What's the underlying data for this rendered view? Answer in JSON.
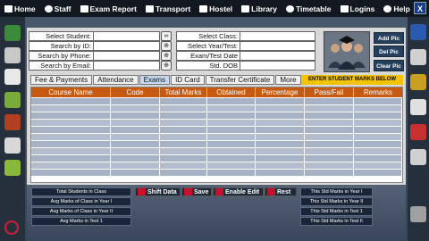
{
  "nav": {
    "items": [
      {
        "label": "Home",
        "icon": "home-icon"
      },
      {
        "label": "Staff",
        "icon": "staff-icon"
      },
      {
        "label": "Exam Report",
        "icon": "report-icon"
      },
      {
        "label": "Transport",
        "icon": "car-icon"
      },
      {
        "label": "Hostel",
        "icon": "hostel-icon"
      },
      {
        "label": "Library",
        "icon": "library-icon"
      },
      {
        "label": "Timetable",
        "icon": "timetable-icon"
      },
      {
        "label": "Logins",
        "icon": "lock-icon"
      },
      {
        "label": "Help",
        "icon": "help-icon"
      }
    ],
    "close": "X"
  },
  "search": {
    "left": [
      {
        "label": "Select Student:",
        "value": ""
      },
      {
        "label": "Search by ID:",
        "value": ""
      },
      {
        "label": "Search by Phone:",
        "value": ""
      },
      {
        "label": "Search by Email:",
        "value": ""
      }
    ],
    "right": [
      {
        "label": "Select Class:",
        "value": ""
      },
      {
        "label": "Select Year/Test:",
        "value": ""
      },
      {
        "label": "Exam/Test Date",
        "value": ""
      },
      {
        "label": "Std. DOB",
        "value": ""
      }
    ]
  },
  "pic_buttons": [
    "Add Pic",
    "Del Pic",
    "Clear Pic"
  ],
  "tabs": [
    "Fee & Payments",
    "Attendance",
    "Exams",
    "ID Card",
    "Transfer Certificate",
    "More"
  ],
  "active_tab": "Exams",
  "banner": "ENTER STUDENT MARKS BELOW",
  "table": {
    "columns": [
      "Course Name",
      "Code",
      "Total Marks",
      "Obtained",
      "Percentage",
      "Pass/Fail",
      "Remarks"
    ],
    "rows": [
      [
        "",
        "",
        "",
        "",
        "",
        "",
        ""
      ],
      [
        "",
        "",
        "",
        "",
        "",
        "",
        ""
      ],
      [
        "",
        "",
        "",
        "",
        "",
        "",
        ""
      ],
      [
        "",
        "",
        "",
        "",
        "",
        "",
        ""
      ],
      [
        "",
        "",
        "",
        "",
        "",
        "",
        ""
      ],
      [
        "",
        "",
        "",
        "",
        "",
        "",
        ""
      ],
      [
        "",
        "",
        "",
        "",
        "",
        "",
        ""
      ],
      [
        "",
        "",
        "",
        "",
        "",
        "",
        ""
      ],
      [
        "",
        "",
        "",
        "",
        "",
        "",
        ""
      ],
      [
        "",
        "",
        "",
        "",
        "",
        "",
        ""
      ],
      [
        "",
        "",
        "",
        "",
        "",
        "",
        ""
      ]
    ]
  },
  "left_stats": [
    "Total Students in Class",
    "Avg Marks of Class in Year I",
    "Avg Marks of Class in Year II",
    "Avg Marks in Test 1"
  ],
  "actions": [
    {
      "label": "Shift Data",
      "icon": "shift-icon"
    },
    {
      "label": "Save",
      "icon": "check-icon"
    },
    {
      "label": "Enable Edit",
      "icon": "edit-icon"
    },
    {
      "label": "Rest",
      "icon": "reset-icon"
    }
  ],
  "right_stats": [
    "This Std Marks in Year I",
    "This Std Marks in Year II",
    "This Std Marks in Test 1",
    "This Std Marks in Test II"
  ],
  "colors": {
    "nav_bg": "#111820",
    "header": "#c65a11",
    "banner": "#f5c400",
    "accent": "#c8102e"
  }
}
